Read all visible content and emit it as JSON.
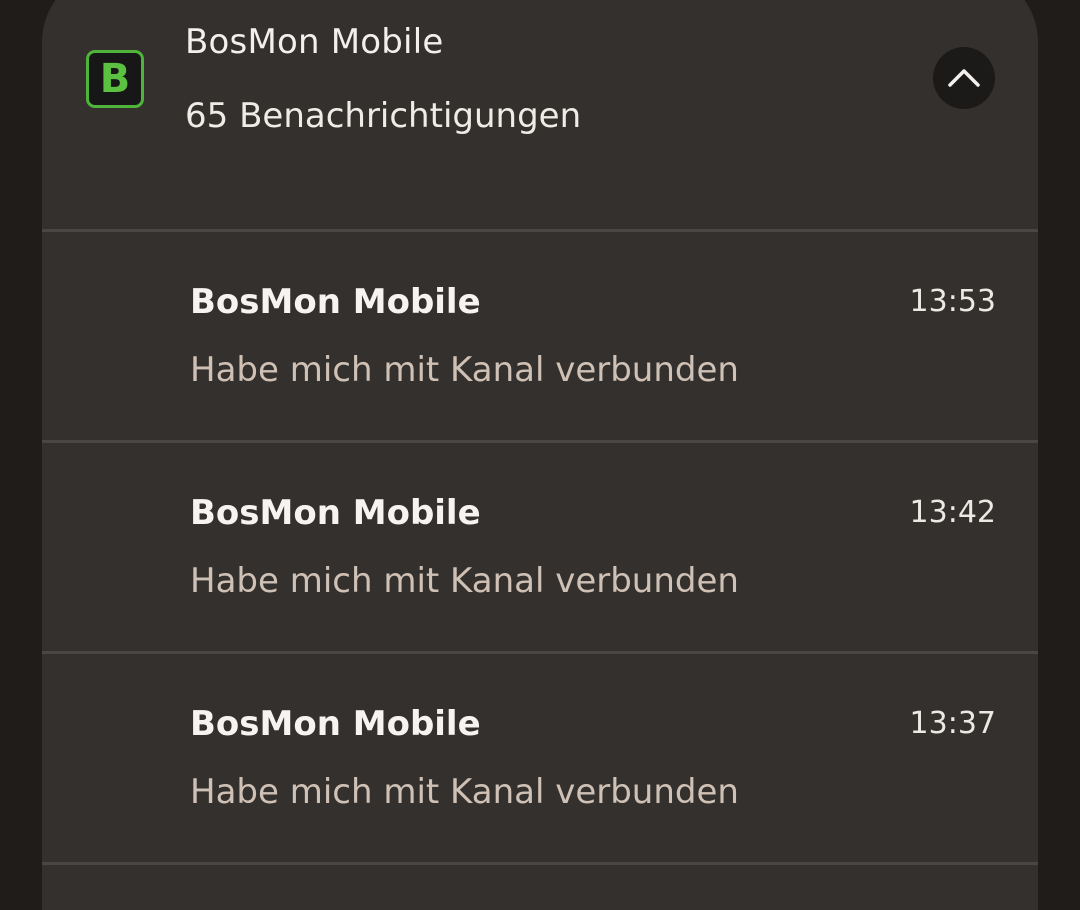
{
  "group": {
    "app_name": "BosMon Mobile",
    "count_text": "65 Benachrichtigungen",
    "icon_letter": "B",
    "icon_name": "app-logo-icon",
    "collapse_icon": "chevron-up-icon"
  },
  "notifications": [
    {
      "title": "BosMon Mobile",
      "time": "13:53",
      "text": "Habe mich mit Kanal verbunden"
    },
    {
      "title": "BosMon Mobile",
      "time": "13:42",
      "text": "Habe mich mit Kanal verbunden"
    },
    {
      "title": "BosMon Mobile",
      "time": "13:37",
      "text": "Habe mich mit Kanal verbunden"
    }
  ],
  "colors": {
    "background": "#1f1c19",
    "card": "#33302d",
    "accent_green": "#4fb53a",
    "secondary_text": "#cfc1b5"
  }
}
